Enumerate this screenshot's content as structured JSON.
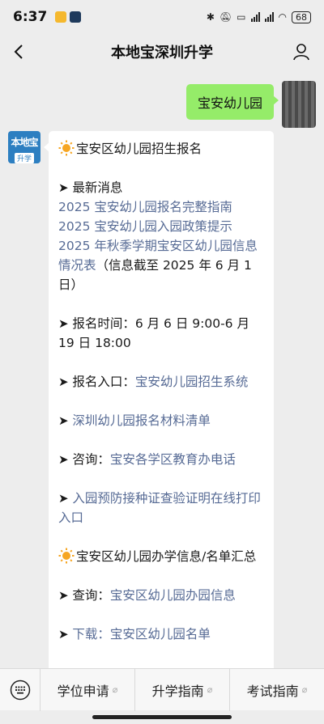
{
  "status": {
    "time": "6:37",
    "battery": "68"
  },
  "nav": {
    "title": "本地宝深圳升学"
  },
  "user_message": "宝安幼儿园",
  "bot_avatar": {
    "line1": "本地宝",
    "line2": "升学"
  },
  "reply": {
    "title": "宝安区幼儿园招生报名",
    "latest_label": "最新消息",
    "link1": "2025 宝安幼儿园报名完整指南",
    "link2": "2025 宝安幼儿园入园政策提示",
    "link3": "2025 年秋季学期宝安区幼儿园信息情况表",
    "link3_note": "（信息截至 2025 年 6 月 1 日）",
    "time_text": "报名时间：6 月 6 日 9:00-6 月 19 日 18:00",
    "entry_label": "报名入口：",
    "entry_link": "宝安幼儿园招生系统",
    "materials_link": "深圳幼儿园报名材料清单",
    "consult_label": "咨询：",
    "consult_link": "宝安各学区教育办电话",
    "vaccine_link": "入园预防接种证查验证明在线打印入口",
    "section2_title": "宝安区幼儿园办学信息/名单汇总",
    "query_label": "查询：",
    "query_link": "宝安区幼儿园办园信息",
    "cut_line": "下载：宝安区幼儿园名单"
  },
  "menu": {
    "item1": "学位申请",
    "item2": "升学指南",
    "item3": "考试指南"
  },
  "icons": {
    "back": "back-arrow-icon",
    "user": "user-profile-icon",
    "keyboard": "keyboard-icon",
    "sun": "sun-emoji-icon"
  }
}
